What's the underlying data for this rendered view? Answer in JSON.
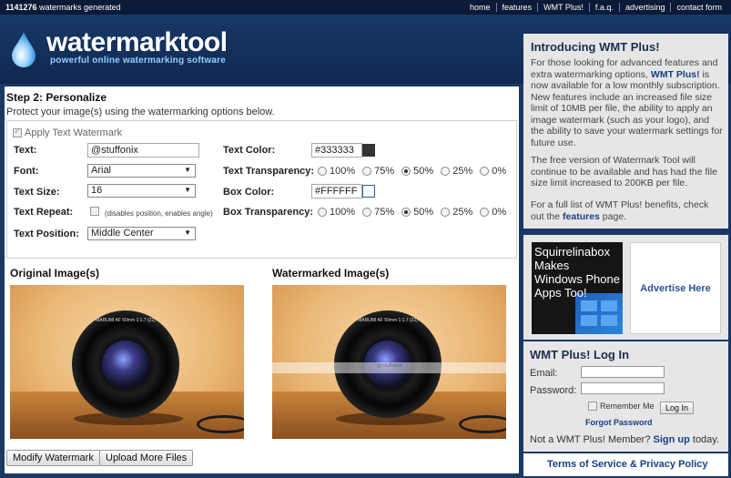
{
  "topbar": {
    "count": "1141276",
    "count_suffix": " watermarks generated",
    "nav": [
      "home",
      "features",
      "WMT Plus!",
      "f.a.q.",
      "advertising",
      "contact form"
    ]
  },
  "header": {
    "logo": "watermarktool",
    "tagline": "powerful online watermarking software"
  },
  "step": {
    "title": "Step 2: Personalize",
    "subtitle": "Protect your image(s) using the watermarking options below."
  },
  "form": {
    "apply_label": "Apply Text Watermark",
    "text_label": "Text:",
    "text_value": "@stuffonix",
    "font_label": "Font:",
    "font_value": "Arial",
    "size_label": "Text Size:",
    "size_value": "16",
    "repeat_label": "Text Repeat:",
    "repeat_hint": "(disables position, enables angle)",
    "position_label": "Text Position:",
    "position_value": "Middle Center",
    "text_color_label": "Text Color:",
    "text_color_value": "#333333",
    "text_transparency_label": "Text Transparency:",
    "box_color_label": "Box Color:",
    "box_color_value": "#FFFFFF",
    "box_transparency_label": "Box Transparency:",
    "transparency_options": [
      "100%",
      "75%",
      "50%",
      "25%",
      "0%"
    ],
    "transparency_selected": "50%"
  },
  "images": {
    "original_title": "Original Image(s)",
    "watermarked_title": "Watermarked Image(s)",
    "lens_text": "MARUMI AF 50mm 1:1.7 (22)",
    "watermark_text": "@stuffonix"
  },
  "buttons": {
    "modify": "Modify Watermark",
    "upload": "Upload More Files"
  },
  "sidebar": {
    "intro_title": "Introducing WMT Plus!",
    "p1_a": "For those looking for advanced features and extra watermarking options, ",
    "p1_link": "WMT Plus!",
    "p1_b": " is now available for a low monthly subscription. New features include an increased file size limit of 10MB per file, the ability to apply an image watermark (such as your logo), and the ability to save your watermark settings for future use.",
    "p2": "The free version of Watermark Tool will continue to be available and has had the file size limit increased to 200KB per file.",
    "p3_a": "For a full list of WMT Plus! benefits, check out the ",
    "p3_link": "features",
    "p3_b": " page.",
    "ad1": "Squirrelinabox Makes Windows Phone Apps Too!",
    "ad2": "Advertise Here",
    "login_title": "WMT Plus! Log In",
    "email_label": "Email:",
    "password_label": "Password:",
    "remember_label": "Remember Me",
    "login_button": "Log In",
    "forgot": "Forgot Password",
    "notmember_a": "Not a WMT Plus! Member? ",
    "notmember_link": "Sign up",
    "notmember_b": " today.",
    "terms": "Terms of Service & Privacy Policy"
  },
  "colors": {
    "background": "#1b3864",
    "topbar": "#0b1a36",
    "link": "#1a3f86",
    "tagline": "#8fd0ff",
    "text_swatch": "#333333",
    "box_swatch": "#FFFFFF"
  }
}
